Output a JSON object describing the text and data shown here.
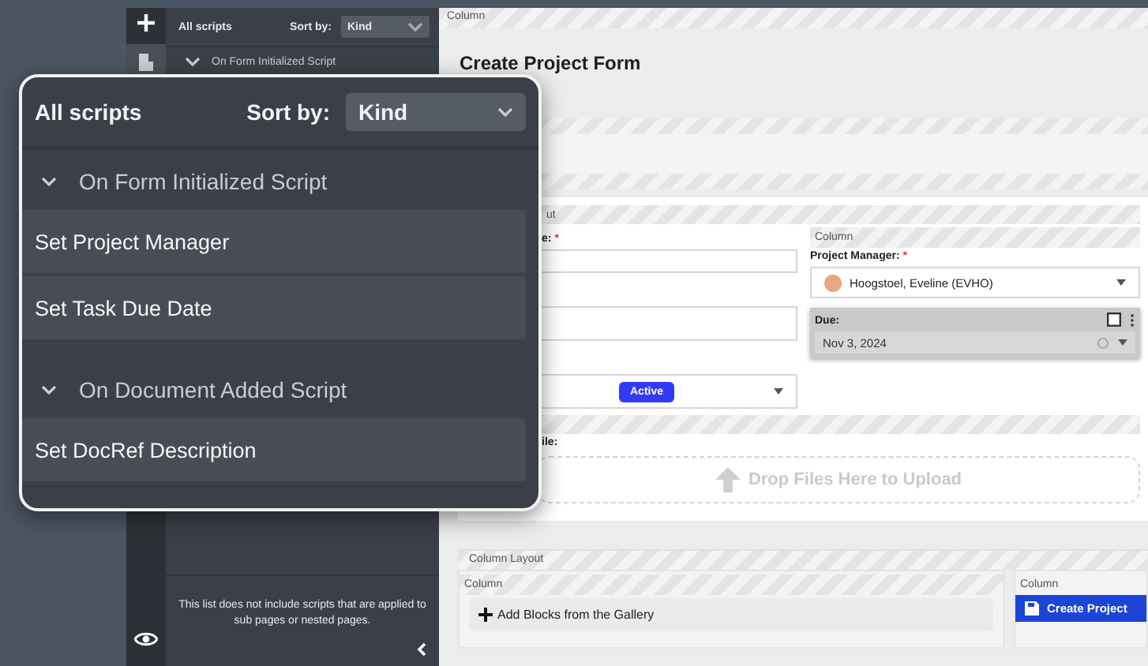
{
  "scripts_panel": {
    "title": "All scripts",
    "sort_label": "Sort by:",
    "sort_value": "Kind",
    "groups": [
      {
        "name": "On Form Initialized Script",
        "expanded": true
      }
    ],
    "footer_note": "This list does not include scripts that are applied to sub pages or nested pages."
  },
  "zoom_panel": {
    "title": "All scripts",
    "sort_label": "Sort by:",
    "sort_value": "Kind",
    "groups": [
      {
        "name": "On Form Initialized Script",
        "expanded": true,
        "items": [
          "Set Project Manager",
          "Set Task Due Date"
        ]
      },
      {
        "name": "On Document Added Script",
        "expanded": true,
        "items": [
          "Set DocRef Description"
        ]
      }
    ]
  },
  "form": {
    "column_label": "Column",
    "title": "Create Project Form",
    "layout_label": "ut",
    "left_fields": [
      {
        "kind": "text",
        "label": "e:",
        "required_mark": "*"
      },
      {
        "kind": "text"
      },
      {
        "kind": "select",
        "badge": "Active"
      }
    ],
    "right_column_label": "Column",
    "project_manager": {
      "label": "Project Manager:",
      "required_mark": "*",
      "value": "Hoogstoel, Eveline (EVHO)"
    },
    "due": {
      "label": "Due:",
      "value": "Nov 3, 2024",
      "selected": true
    },
    "upload": {
      "label": "ile:",
      "prompt": "Drop Files Here to Upload"
    },
    "bottom": {
      "layout_label": "Column Layout",
      "columns": [
        {
          "label": "Column",
          "kind": "add",
          "text": "Add Blocks from the Gallery"
        },
        {
          "label": "Column",
          "kind": "button",
          "text": "Create Project"
        }
      ]
    }
  }
}
